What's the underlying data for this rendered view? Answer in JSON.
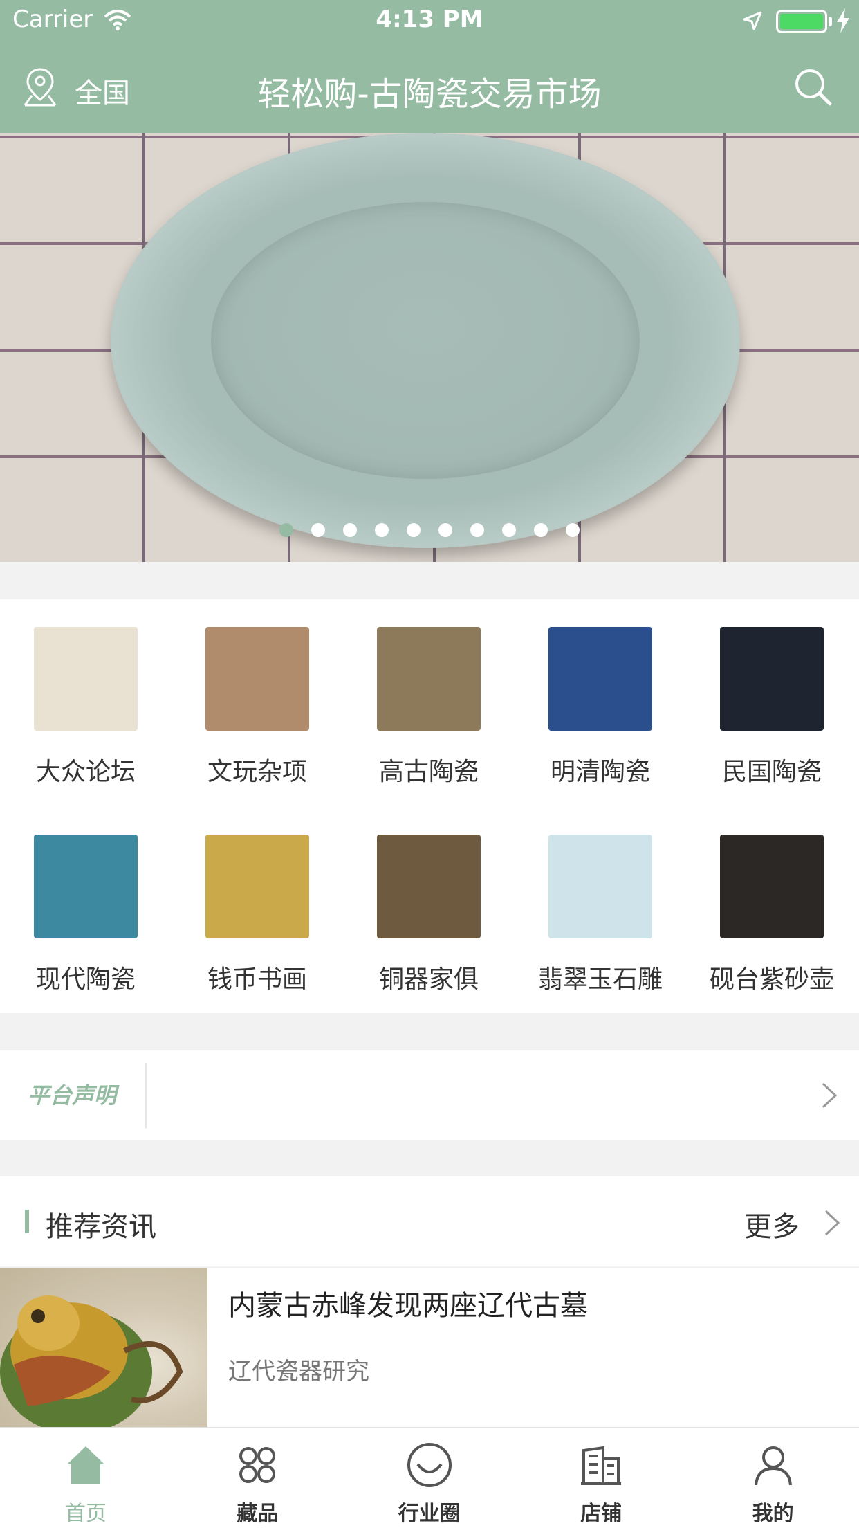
{
  "status_bar": {
    "carrier": "Carrier",
    "time": "4:13 PM"
  },
  "nav": {
    "location": "全国",
    "title": "轻松购-古陶瓷交易市场"
  },
  "banner": {
    "dot_count": 10,
    "active_index": 0
  },
  "categories": [
    {
      "label": "大众论坛",
      "color": "#e9e1d1"
    },
    {
      "label": "文玩杂项",
      "color": "#b08b6c"
    },
    {
      "label": "高古陶瓷",
      "color": "#8c7a5a"
    },
    {
      "label": "明清陶瓷",
      "color": "#2a4f8c"
    },
    {
      "label": "民国陶瓷",
      "color": "#1e2430"
    },
    {
      "label": "现代陶瓷",
      "color": "#3d8aa0"
    },
    {
      "label": "钱币书画",
      "color": "#caa94a"
    },
    {
      "label": "铜器家俱",
      "color": "#6e5a3e"
    },
    {
      "label": "翡翠玉石雕",
      "color": "#cfe4ea"
    },
    {
      "label": "砚台紫砂壶",
      "color": "#2c2826"
    }
  ],
  "notice": {
    "tag": "平台声明"
  },
  "recommend": {
    "title": "推荐资讯",
    "more": "更多"
  },
  "news": [
    {
      "title": "内蒙古赤峰发现两座辽代古墓",
      "subtitle": "辽代瓷器研究"
    }
  ],
  "tabs": [
    {
      "label": "首页",
      "icon": "home-icon",
      "active": true
    },
    {
      "label": "藏品",
      "icon": "grid-icon",
      "active": false
    },
    {
      "label": "行业圈",
      "icon": "smile-icon",
      "active": false
    },
    {
      "label": "店铺",
      "icon": "store-icon",
      "active": false
    },
    {
      "label": "我的",
      "icon": "user-icon",
      "active": false
    }
  ],
  "colors": {
    "accent": "#96bba3"
  }
}
